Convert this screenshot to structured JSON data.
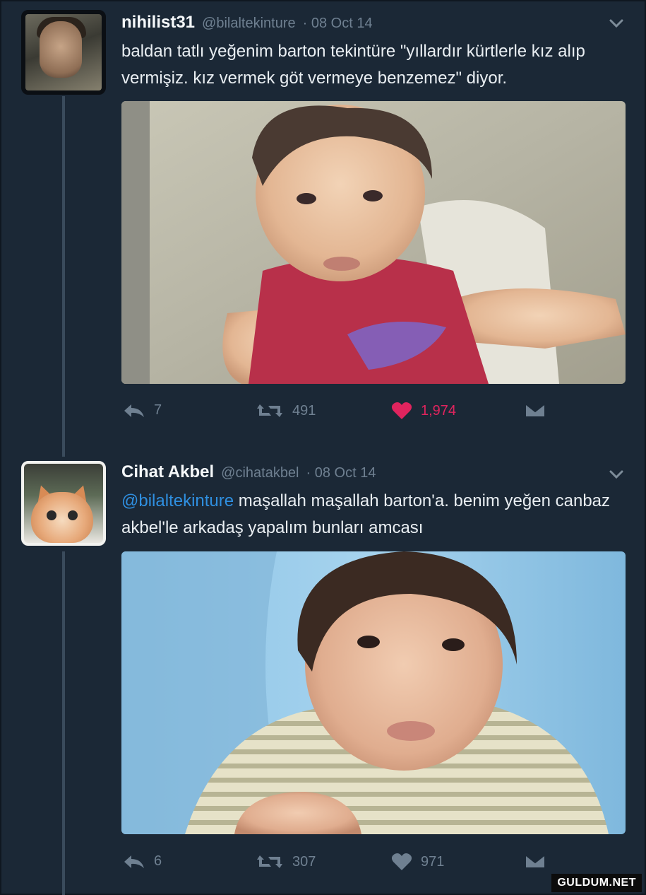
{
  "tweets": [
    {
      "display_name": "nihilist31",
      "handle": "@bilaltekinture",
      "date": "· 08 Oct 14",
      "text_before": "",
      "mention": "",
      "text": "baldan tatlı yeğenim barton tekintüre \"yıllardır kürtlerle kız alıp vermişiz. kız vermek göt vermeye benzemez\" diyor.",
      "avatar_icon": "profile-photo-boy",
      "media_icon": "baby-photo-red-shirt",
      "actions": {
        "reply_count": "7",
        "retweet_count": "491",
        "like_count": "1,974",
        "liked": true
      }
    },
    {
      "display_name": "Cihat Akbel",
      "handle": "@cihatakbel",
      "date": "· 08 Oct 14",
      "mention": "@bilaltekinture",
      "text": " maşallah maşallah barton'a. benim yeğen canbaz akbel'le arkadaş yapalım bunları amcası",
      "avatar_icon": "profile-photo-cat",
      "media_icon": "baby-photo-striped-shirt",
      "actions": {
        "reply_count": "6",
        "retweet_count": "307",
        "like_count": "971",
        "liked": false
      }
    }
  ],
  "colors": {
    "background": "#1b2836",
    "muted": "#6f8091",
    "link": "#2f8fe0",
    "like_active": "#e0245e"
  },
  "watermark": "GULDUM.NET"
}
